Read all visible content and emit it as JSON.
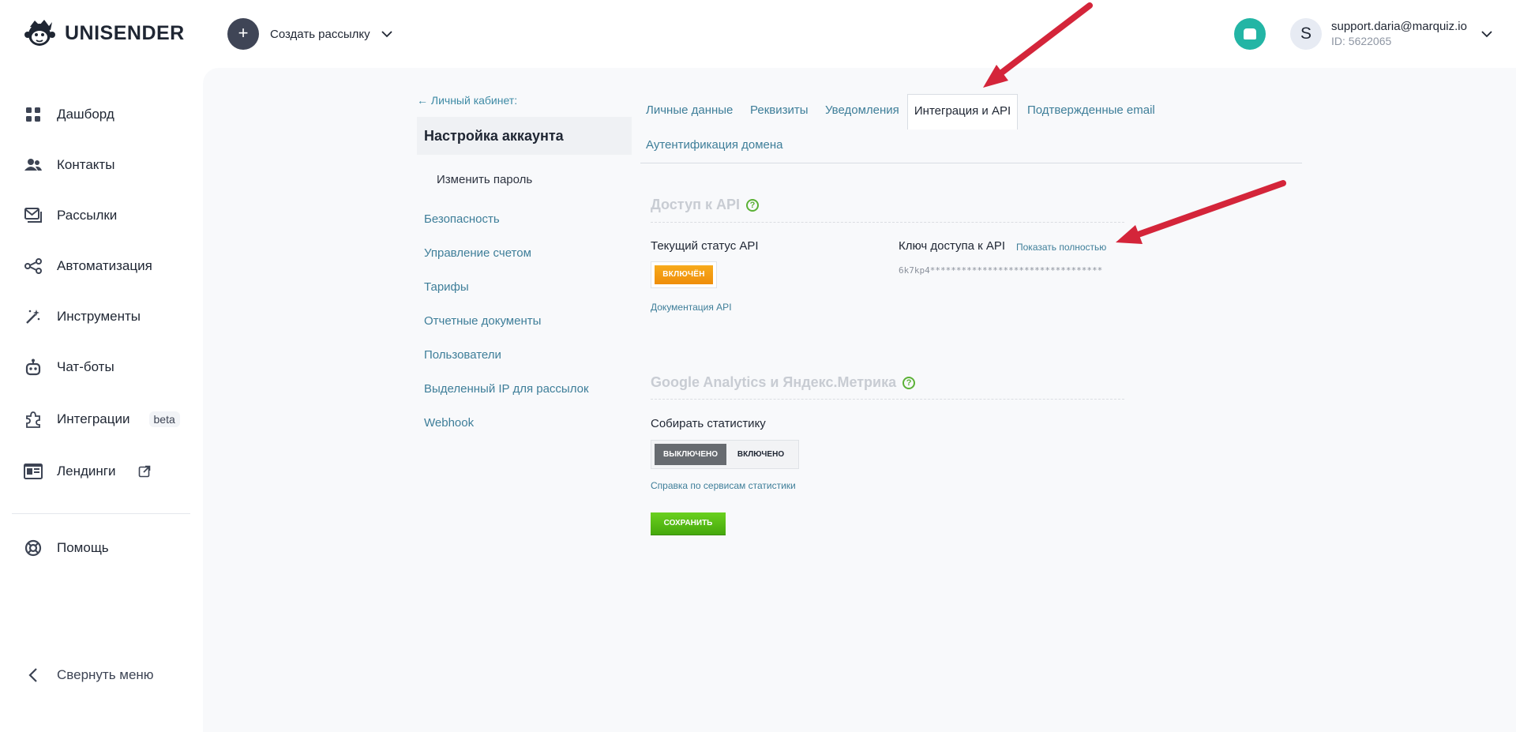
{
  "header": {
    "logo_text": "UNISENDER",
    "create_label": "Создать рассылку",
    "create_icon": "+",
    "user": {
      "initial": "S",
      "email": "support.daria@marquiz.io",
      "id": "ID: 5622065"
    }
  },
  "sidebar": {
    "items": [
      {
        "label": "Дашборд",
        "icon": "dashboard-icon"
      },
      {
        "label": "Контакты",
        "icon": "contacts-icon"
      },
      {
        "label": "Рассылки",
        "icon": "mail-icon"
      },
      {
        "label": "Автоматизация",
        "icon": "automation-icon"
      },
      {
        "label": "Инструменты",
        "icon": "magic-wand-icon"
      },
      {
        "label": "Чат-боты",
        "icon": "robot-icon"
      },
      {
        "label": "Интеграции",
        "icon": "puzzle-icon",
        "badge": "beta"
      },
      {
        "label": "Лендинги",
        "icon": "landing-icon"
      }
    ],
    "help": "Помощь",
    "collapse": "Свернуть меню"
  },
  "settings": {
    "back": "← Личный кабинет:",
    "title": "Настройка аккаунта",
    "sub": "Изменить пароль",
    "links": [
      "Безопасность",
      "Управление счетом",
      "Тарифы",
      "Отчетные документы",
      "Пользователи",
      "Выделенный IP для рассылок",
      "Webhook"
    ]
  },
  "tabs": {
    "personal": "Личные данные",
    "requisites": "Реквизиты",
    "notifications": "Уведомления",
    "integration": "Интеграция и API",
    "confirmed": "Подтвержденные email",
    "domain": "Аутентификация домена"
  },
  "api": {
    "title": "Доступ к API",
    "help": "?",
    "status_label": "Текущий статус API",
    "status_value": "ВКЛЮЧЁН",
    "docs_link": "Документация API",
    "key_label": "Ключ доступа к API",
    "show_full": "Показать полностью",
    "key_value": "6k7kp4*********************************"
  },
  "analytics": {
    "title": "Google Analytics и Яндекс.Метрика",
    "help": "?",
    "collect_label": "Собирать статистику",
    "off_label": "ВЫКЛЮЧЕНО",
    "on_label": "ВКЛЮЧЕНО",
    "help_link": "Справка по сервисам статистики",
    "save_label": "СОХРАНИТЬ"
  },
  "colors": {
    "accent_link": "#3e7e99",
    "status_orange": "#f39a12",
    "save_green": "#55b814",
    "annotation_red": "#d4253a"
  }
}
